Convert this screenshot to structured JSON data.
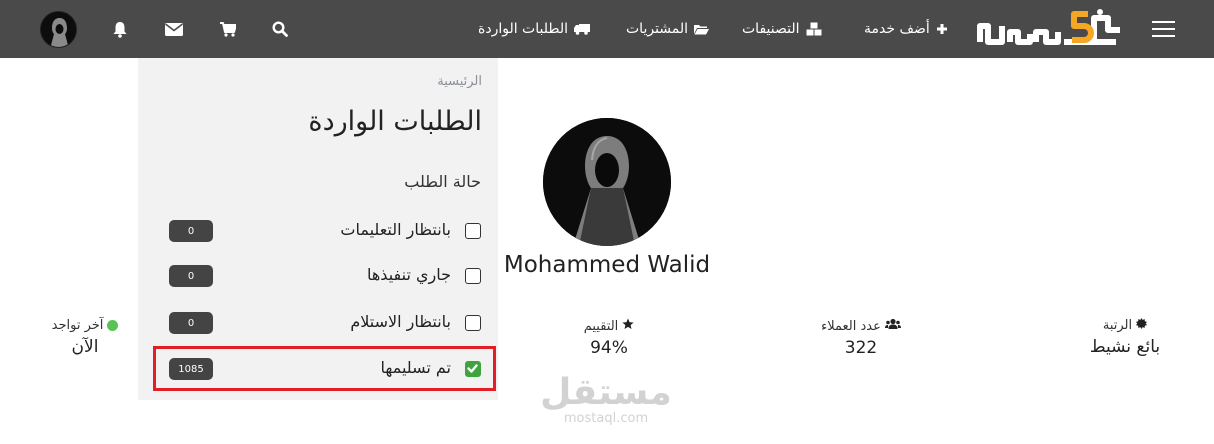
{
  "nav": {
    "logo_text": "خمسات",
    "links": {
      "add_service": "أضف خدمة",
      "categories": "التصنيفات",
      "purchases": "المشتريات",
      "incoming_orders": "الطلبات الواردة"
    },
    "icons": {
      "menu": "hamburger-icon",
      "add_service": "plus-icon",
      "categories": "cubes-icon",
      "purchases": "folder-open-icon",
      "incoming_orders": "truck-icon",
      "search": "search-icon",
      "cart": "cart-icon",
      "messages": "envelope-icon",
      "notifications": "bell-icon"
    },
    "background_color": "#4a4a4a",
    "accent_color": "#f5a623"
  },
  "sidebar": {
    "breadcrumb": "الرئيسية",
    "title": "الطلبات الواردة",
    "filter_title": "حالة الطلب",
    "filters": [
      {
        "label": "بانتظار التعليمات",
        "count": "0",
        "checked": false
      },
      {
        "label": "جاري تنفيذها",
        "count": "0",
        "checked": false
      },
      {
        "label": "بانتظار الاستلام",
        "count": "0",
        "checked": false
      },
      {
        "label": "تم تسليمها",
        "count": "1085",
        "checked": true
      }
    ],
    "highlight_color": "#e31e24"
  },
  "profile": {
    "name": "Mohammed Walid",
    "stats": {
      "rank": {
        "label": "الرتبة",
        "value": "بائع نشيط",
        "icon": "certificate-icon"
      },
      "clients": {
        "label": "عدد العملاء",
        "value": "322",
        "icon": "users-icon"
      },
      "rating": {
        "label": "التقييم",
        "value": "94%",
        "icon": "star-icon"
      },
      "last_seen": {
        "label": "آخر تواجد",
        "value": "الآن",
        "status_color": "#57c255"
      }
    }
  },
  "watermark": {
    "arabic": "مستقل",
    "latin": "mostaql.com"
  }
}
